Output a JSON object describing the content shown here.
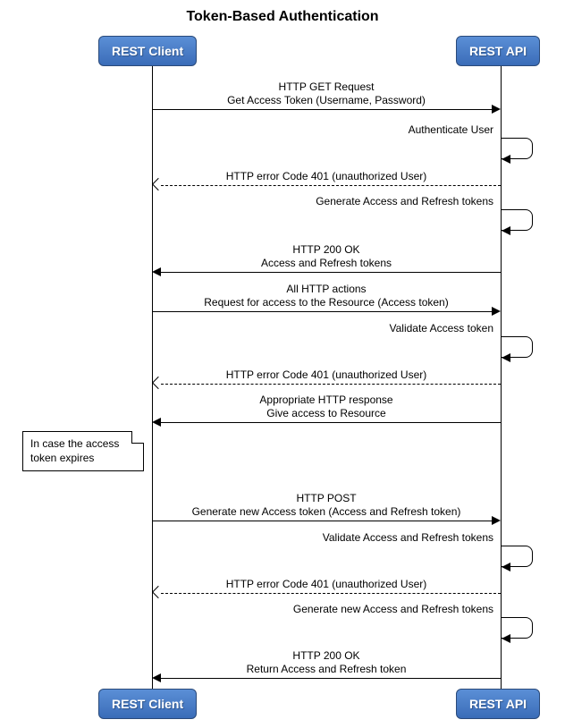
{
  "title": "Token-Based Authentication",
  "participants": {
    "client": "REST Client",
    "api": "REST API"
  },
  "messages": {
    "m1a": "HTTP GET Request",
    "m1b": "Get Access Token (Username, Password)",
    "m2": "Authenticate User",
    "m3": "HTTP error Code 401 (unauthorized User)",
    "m4": "Generate Access and Refresh tokens",
    "m5a": "HTTP 200 OK",
    "m5b": "Access and Refresh tokens",
    "m6a": "All HTTP actions",
    "m6b": "Request for access to the Resource (Access token)",
    "m7": "Validate Access token",
    "m8": "HTTP error Code 401 (unauthorized User)",
    "m9a": "Appropriate HTTP response",
    "m9b": "Give access to Resource",
    "note1": "In case the access token expires",
    "m10a": "HTTP POST",
    "m10b": "Generate new Access token (Access and Refresh token)",
    "m11": "Validate Access and Refresh tokens",
    "m12": "HTTP error Code 401 (unauthorized User)",
    "m13": "Generate new Access and Refresh tokens",
    "m14a": "HTTP 200 OK",
    "m14b": "Return Access and Refresh token"
  }
}
